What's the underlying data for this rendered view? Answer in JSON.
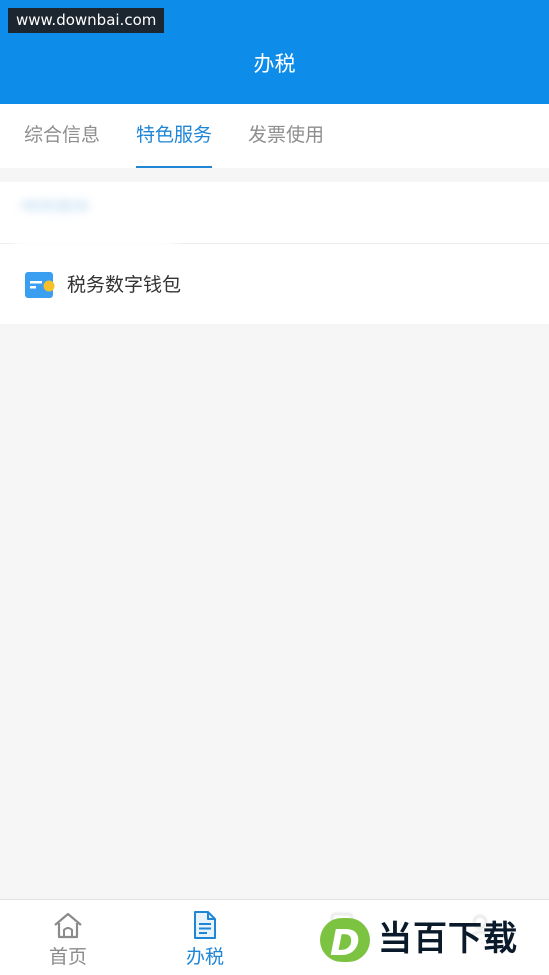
{
  "watermark": {
    "text": "www.downbai.com"
  },
  "header": {
    "title": "办税"
  },
  "tabs": [
    {
      "label": "综合信息",
      "active": false
    },
    {
      "label": "特色服务",
      "active": true
    },
    {
      "label": "发票使用",
      "active": false
    }
  ],
  "section": {
    "title": "特色服务",
    "items": [
      {
        "label": "税务数字钱包",
        "icon": "wallet-icon"
      }
    ]
  },
  "bottom_nav": [
    {
      "label": "首页",
      "icon": "home-icon",
      "active": false
    },
    {
      "label": "办税",
      "icon": "document-icon",
      "active": true
    }
  ],
  "logo": {
    "letter": "D",
    "text": "当百下载"
  },
  "colors": {
    "header": "#0e8cea",
    "accent": "#1f86d6",
    "background": "#f6f6f6",
    "wallet_blue": "#3a9ff0",
    "wallet_yellow": "#f5c02a",
    "logo_green": "#7cc341"
  }
}
